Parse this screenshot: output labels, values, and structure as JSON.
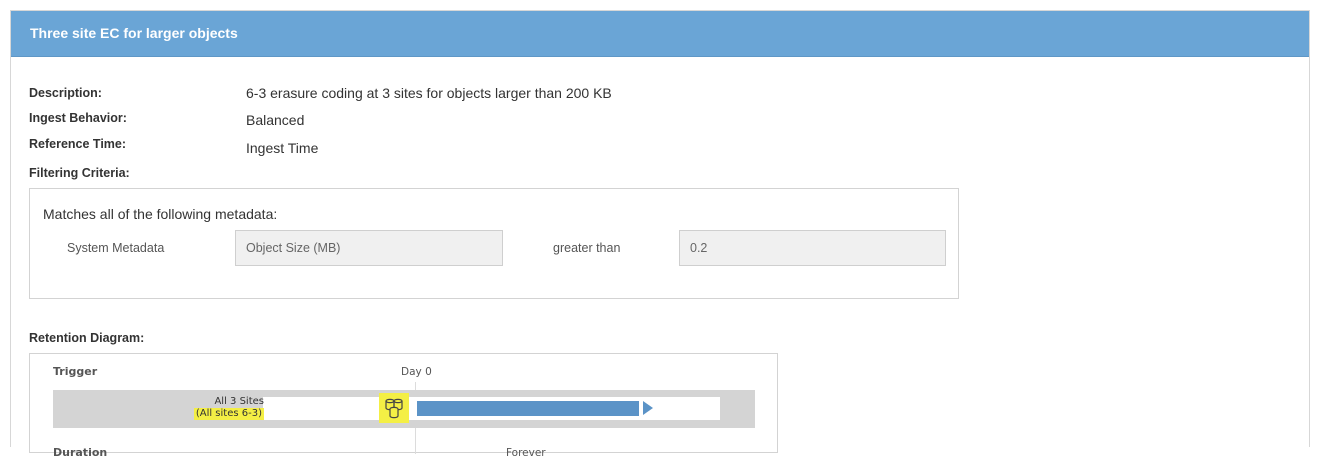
{
  "panel": {
    "title": "Three site EC for larger objects"
  },
  "details": {
    "description_label": "Description:",
    "description_value": "6-3 erasure coding at 3 sites for objects larger than 200 KB",
    "ingest_label": "Ingest Behavior:",
    "ingest_value": "Balanced",
    "reference_label": "Reference Time:",
    "reference_value": "Ingest Time",
    "filtering_label": "Filtering Criteria:"
  },
  "filter": {
    "intro": "Matches all of the following metadata:",
    "type": "System Metadata",
    "field": "Object Size (MB)",
    "operator": "greater than",
    "value": "0.2"
  },
  "retention": {
    "label": "Retention Diagram:",
    "trigger_label": "Trigger",
    "day_label": "Day 0",
    "site_line1": "All 3 Sites",
    "site_line2": "(All sites 6-3)",
    "duration_label": "Duration",
    "forever_label": "Forever",
    "site_icon": "storage-pool-icon",
    "highlight_color": "#f4ef45",
    "bar_color": "#5b93c7",
    "header_color": "#6aa5d6"
  }
}
